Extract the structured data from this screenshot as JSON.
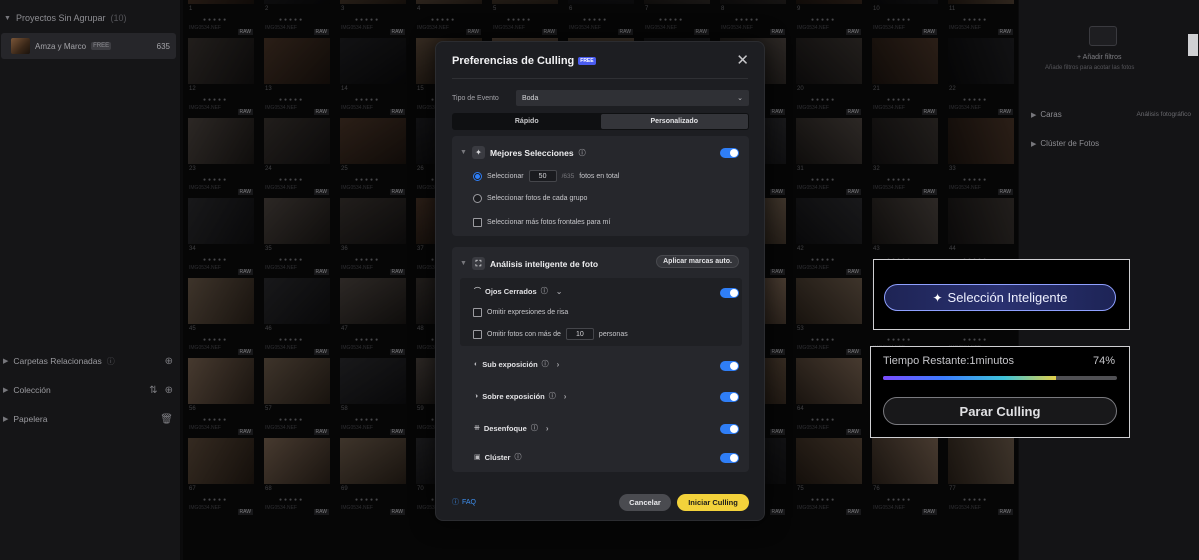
{
  "sidebar": {
    "section_title": "Proyectos Sin Agrupar",
    "section_count": "(10)",
    "project": {
      "name": "Amza y Marco",
      "badge": "FREE",
      "count": "635"
    },
    "rows": [
      {
        "label": "Carpetas Relacionadas"
      },
      {
        "label": "Colección"
      },
      {
        "label": "Papelera"
      }
    ]
  },
  "grid": {
    "raw_tag": "RAW",
    "file_tag": "IMG0534.NEF",
    "numbers": [
      "1",
      "2",
      "3",
      "4",
      "5",
      "6",
      "7",
      "8",
      "9",
      "10",
      "11",
      "12",
      "13",
      "14",
      "15",
      "16",
      "17",
      "18",
      "19",
      "20",
      "21",
      "22",
      "23",
      "24",
      "25",
      "26",
      "27",
      "28",
      "29",
      "30",
      "31",
      "32",
      "33",
      "34",
      "35",
      "36",
      "37",
      "38",
      "39",
      "40",
      "41",
      "42",
      "43",
      "44",
      "45",
      "46",
      "47",
      "48",
      "49",
      "50",
      "51",
      "52",
      "53",
      "54",
      "55",
      "56",
      "57",
      "58",
      "59",
      "60",
      "61",
      "62",
      "63",
      "64",
      "65",
      "66",
      "67",
      "68",
      "69",
      "70",
      "71",
      "72",
      "73",
      "74",
      "75",
      "76",
      "77",
      "78",
      "79",
      "80",
      "81",
      "82",
      "83",
      "84",
      "85",
      "86",
      "87",
      "88",
      "89",
      "90",
      "91",
      "92",
      "93",
      "94",
      "95",
      "96",
      "97",
      "98",
      "99",
      "100",
      "101",
      "102",
      "103",
      "104",
      "105",
      "106",
      "107",
      "108",
      "109",
      "110",
      "111",
      "112",
      "113",
      "114",
      "115",
      "116",
      "117",
      "118",
      "119",
      "120"
    ]
  },
  "right_panel": {
    "add_filters": "Añadir filtros",
    "add_filters_sub": "Añade filtros para acotar las fotos",
    "rows": [
      {
        "label": "Caras",
        "aux": "Análisis fotográfico"
      },
      {
        "label": "Clúster de Fotos",
        "aux": ""
      }
    ]
  },
  "dialog": {
    "title": "Preferencias de Culling",
    "free_badge": "FREE",
    "event_label": "Tipo de Evento",
    "event_value": "Boda",
    "modes": [
      "Rápido",
      "Personalizado"
    ],
    "active_mode": "Personalizado",
    "best": {
      "title": "Mejores Selecciones",
      "enabled": true,
      "select_label": "Seleccionar",
      "select_value": "50",
      "select_of": "/635",
      "select_suffix": "fotos en total",
      "group_label": "Seleccionar fotos de cada grupo",
      "frontal_label": "Seleccionar más fotos frontales para mí"
    },
    "analysis": {
      "title": "Análisis inteligente de foto",
      "apply_label": "Aplicar marcas auto.",
      "closed_eyes": "Ojos Cerrados",
      "closed_eyes_on": true,
      "skip_laugh": "Omitir expresiones de risa",
      "skip_many_prefix": "Omitir fotos con más de",
      "skip_many_value": "10",
      "skip_many_suffix": "personas",
      "features": [
        {
          "label": "Sub exposición",
          "icon": "half-circle-icon",
          "on": true
        },
        {
          "label": "Sobre exposición",
          "icon": "half-circle-filled-icon",
          "on": true
        },
        {
          "label": "Desenfoque",
          "icon": "dotted-grid-icon",
          "on": true
        },
        {
          "label": "Clúster",
          "icon": "stack-icon",
          "on": true
        }
      ]
    },
    "faq": "FAQ",
    "cancel": "Cancelar",
    "start": "Iniciar Culling"
  },
  "smart_selection": {
    "label": "Selección Inteligente"
  },
  "progress": {
    "label": "Tiempo Restante:1minutos",
    "percent_text": "74%",
    "percent": 74,
    "stop": "Parar Culling"
  }
}
